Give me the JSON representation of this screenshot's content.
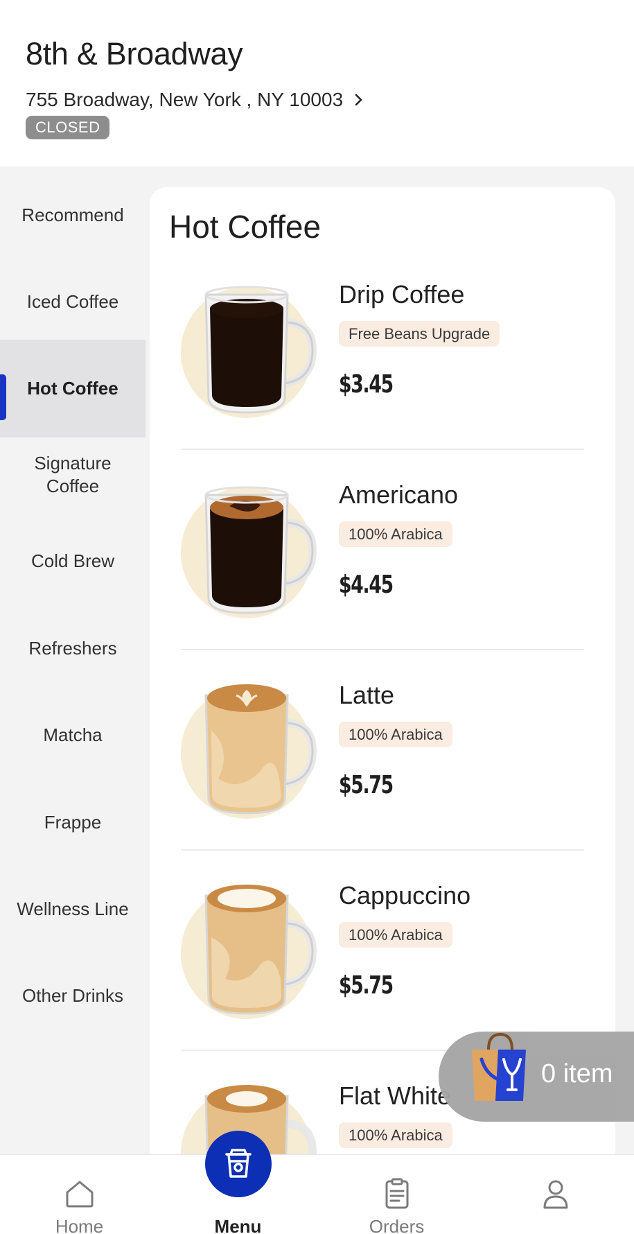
{
  "store": {
    "name": "8th & Broadway",
    "address": "755 Broadway, New York , NY 10003",
    "status": "CLOSED"
  },
  "sidebar": {
    "items": [
      {
        "label": "Recommend"
      },
      {
        "label": "Iced Coffee"
      },
      {
        "label": "Hot Coffee",
        "active": true
      },
      {
        "label": "Signature Coffee"
      },
      {
        "label": "Cold Brew"
      },
      {
        "label": "Refreshers"
      },
      {
        "label": "Matcha"
      },
      {
        "label": "Frappe"
      },
      {
        "label": "Wellness Line"
      },
      {
        "label": "Other Drinks"
      }
    ]
  },
  "menu": {
    "section_title": "Hot Coffee",
    "products": [
      {
        "name": "Drip Coffee",
        "tag": "Free Beans Upgrade",
        "price": "$3.45",
        "drink": "black-coffee"
      },
      {
        "name": "Americano",
        "tag": "100% Arabica",
        "price": "$4.45",
        "drink": "americano"
      },
      {
        "name": "Latte",
        "tag": "100% Arabica",
        "price": "$5.75",
        "drink": "latte"
      },
      {
        "name": "Cappuccino",
        "tag": "100% Arabica",
        "price": "$5.75",
        "drink": "cappuccino"
      },
      {
        "name": "Flat White",
        "tag": "100% Arabica",
        "price": "",
        "drink": "flat-white"
      }
    ]
  },
  "cart": {
    "count_label": "0 item",
    "icon": "shopping-bag-icon"
  },
  "nav": {
    "tabs": [
      {
        "label": "Home",
        "icon": "home-icon"
      },
      {
        "label": "Menu",
        "icon": "cup-icon",
        "active": true
      },
      {
        "label": "Orders",
        "icon": "orders-icon"
      },
      {
        "label": "",
        "icon": "profile-icon"
      }
    ]
  },
  "colors": {
    "accent": "#1a34c2",
    "tag_bg": "#fbece1",
    "badge_bg": "#8d8d8d",
    "sidebar_bg": "#f3f3f3"
  }
}
